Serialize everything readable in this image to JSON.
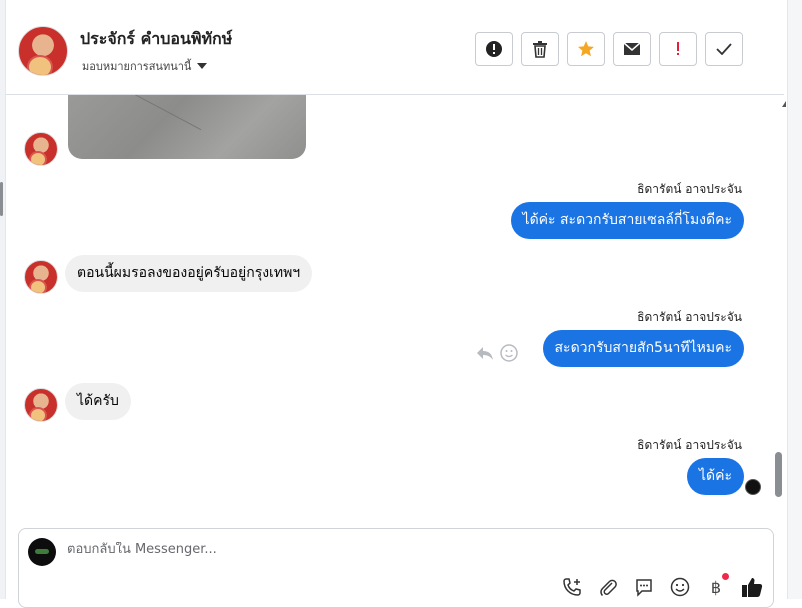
{
  "header": {
    "contact_name": "ประจักร์ คำบอนพิทักษ์",
    "assign_label": "มอบหมายการสนทนานี้"
  },
  "toolbar": {
    "buttons": [
      "report-icon",
      "trash-icon",
      "star-icon",
      "mail-icon",
      "important-icon",
      "check-icon"
    ],
    "star_color": "#f5a623",
    "important_color": "#e41e3f"
  },
  "messages": [
    {
      "type": "image",
      "direction": "in"
    },
    {
      "type": "text",
      "direction": "out",
      "sender": "ธิดารัตน์ อาจประจัน",
      "text": "ได้ค่ะ สะดวกรับสายเซลล์กี่โมงดีคะ"
    },
    {
      "type": "text",
      "direction": "in",
      "text": "ตอนนี้ผมรอลงของอยู่ครับอยู่กรุงเทพฯ"
    },
    {
      "type": "text",
      "direction": "out",
      "sender": "ธิดารัตน์ อาจประจัน",
      "text": "สะดวกรับสายสัก5นาทีไหมคะ"
    },
    {
      "type": "text",
      "direction": "in",
      "text": "ได้ครับ"
    },
    {
      "type": "text",
      "direction": "out",
      "sender": "ธิดารัตน์ อาจประจัน",
      "text": "ได้ค่ะ"
    }
  ],
  "composer": {
    "placeholder": "ตอบกลับใน Messenger...",
    "actions": [
      "call-add-icon",
      "attachment-icon",
      "saved-reply-icon",
      "emoji-icon",
      "baht-icon",
      "like-icon"
    ],
    "baht_symbol": "฿"
  },
  "colors": {
    "outgoing_bubble": "#1b74e4",
    "incoming_bubble": "#f0f0f0",
    "like": "#1b1b1b"
  }
}
